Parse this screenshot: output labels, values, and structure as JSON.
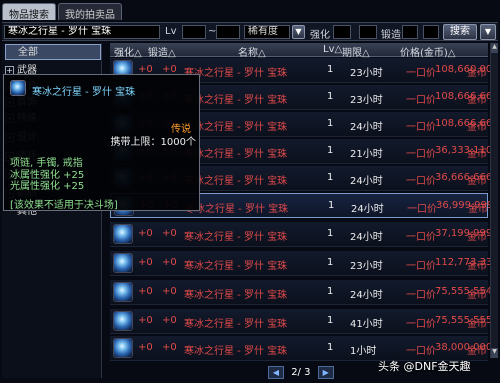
{
  "tabs": [
    "物品搜索",
    "我的拍卖品"
  ],
  "search": {
    "item_name": "寒冰之行星 - 罗什 宝珠",
    "lv_label": "Lv",
    "lv_sep": "~",
    "rarity": "稀有度",
    "enhance_label": "强化",
    "forge_label": "锻造",
    "search_button": "搜索",
    "filter_button": "▼"
  },
  "categories": [
    {
      "label": "全部",
      "plus": ""
    },
    {
      "label": "武器",
      "plus": "+"
    },
    {
      "label": "防具",
      "plus": "+"
    },
    {
      "label": "首饰",
      "plus": "+"
    },
    {
      "label": "特殊",
      "plus": "+"
    },
    {
      "label": "设计",
      "plus": "+"
    },
    {
      "label": "消耗",
      "plus": "+"
    },
    {
      "label": "宠物",
      "plus": "+"
    },
    {
      "label": "副职",
      "plus": "+"
    },
    {
      "label": "其他",
      "plus": ""
    }
  ],
  "columns": {
    "enhance": "强化△",
    "forge": "锻造△",
    "name": "名称△",
    "level": "Lv△",
    "time": "期限△",
    "price": "价格(金币)△"
  },
  "rows": [
    {
      "enhance": "+0",
      "forge": "+0",
      "name": "寒冰之行星 - 罗什 宝珠",
      "level": "1",
      "time": "23小时",
      "unit_label": "一口价",
      "price": "108,660,000",
      "currency": "金币"
    },
    {
      "enhance": "+0",
      "forge": "+0",
      "name": "寒冰之行星 - 罗什 宝珠",
      "level": "1",
      "time": "23小时",
      "unit_label": "一口价",
      "price": "108,666,663",
      "currency": "金币"
    },
    {
      "enhance": "+0",
      "forge": "+0",
      "name": "寒冰之行星 - 罗什 宝珠",
      "level": "1",
      "time": "24小时",
      "unit_label": "一口价",
      "price": "108,666,666",
      "currency": "金币"
    },
    {
      "enhance": "+0",
      "forge": "+0",
      "name": "寒冰之行星 - 罗什 宝珠",
      "level": "1",
      "time": "21小时",
      "unit_label": "一口价",
      "price": "36,333,110",
      "currency": "金币"
    },
    {
      "enhance": "+0",
      "forge": "+0",
      "name": "寒冰之行星 - 罗什 宝珠",
      "level": "1",
      "time": "24小时",
      "unit_label": "一口价",
      "price": "36,666,666",
      "currency": "金币"
    },
    {
      "enhance": "+0",
      "forge": "+0",
      "name": "寒冰之行星 - 罗什 宝珠",
      "level": "1",
      "time": "24小时",
      "unit_label": "一口价",
      "price": "36,999,999",
      "currency": "金币"
    },
    {
      "enhance": "+0",
      "forge": "+0",
      "name": "寒冰之行星 - 罗什 宝珠",
      "level": "1",
      "time": "24小时",
      "unit_label": "一口价",
      "price": "37,199,999",
      "currency": "金币"
    },
    {
      "enhance": "+0",
      "forge": "+0",
      "name": "寒冰之行星 - 罗什 宝珠",
      "level": "1",
      "time": "23小时",
      "unit_label": "一口价",
      "price": "112,773,333",
      "currency": "金币"
    },
    {
      "enhance": "+0",
      "forge": "+0",
      "name": "寒冰之行星 - 罗什 宝珠",
      "level": "1",
      "time": "24小时",
      "unit_label": "一口价",
      "price": "75,555,554",
      "currency": "金币"
    },
    {
      "enhance": "+0",
      "forge": "+0",
      "name": "寒冰之行星 - 罗什 宝珠",
      "level": "1",
      "time": "41小时",
      "unit_label": "一口价",
      "price": "75,555,555",
      "currency": "金币"
    },
    {
      "enhance": "+0",
      "forge": "+0",
      "name": "寒冰之行星 - 罗什 宝珠",
      "level": "1",
      "time": "1小时",
      "unit_label": "一口价",
      "price": "38,000,000",
      "currency": "金币"
    }
  ],
  "tooltip": {
    "title": "寒冰之行星 - 罗什 宝珠",
    "rarity": "传说",
    "carry_limit": "携带上限：1000个",
    "slots": "项链, 手镯, 戒指",
    "stat1": "冰属性强化 +25",
    "stat2": "光属性强化 +25",
    "note": "[该效果不适用于决斗场]"
  },
  "pager": {
    "prev": "◀",
    "page": "2/ 3",
    "next": "▶"
  },
  "watermark": "头条 @DNF金天趣",
  "colors": {
    "price_red": "#e04a4a",
    "tooltip_title": "#7fd8ff",
    "tooltip_stat": "#8fe08f",
    "rarity_orange": "#ff9a2a"
  }
}
